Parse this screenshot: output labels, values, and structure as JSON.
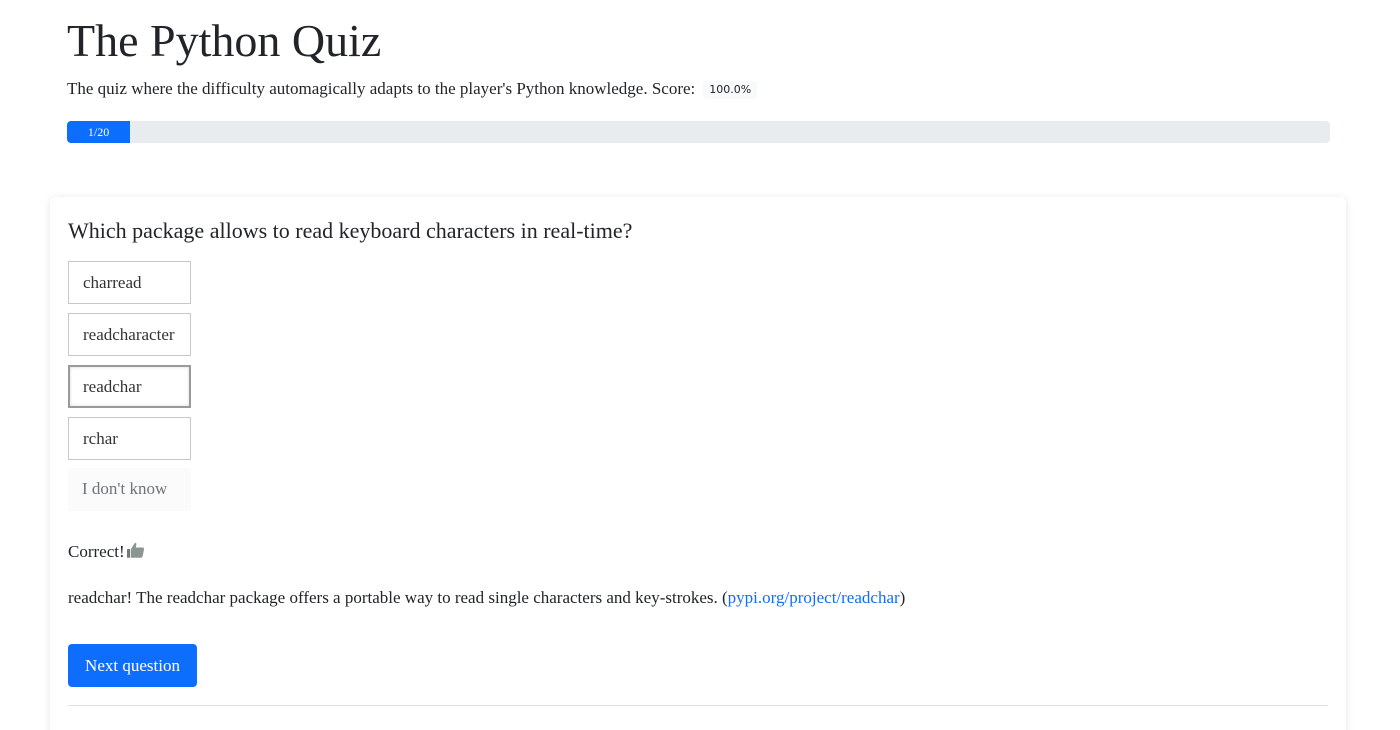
{
  "header": {
    "title": "The Python Quiz",
    "subtitle": "The quiz where the difficulty automagically adapts to the player's Python knowledge. Score:",
    "score": "100.0%"
  },
  "progress": {
    "label": "1/20",
    "current": 1,
    "total": 20,
    "color": "#0d6efd"
  },
  "quiz": {
    "question": "Which package allows to read keyboard characters in real-time?",
    "answers": [
      {
        "label": "charread",
        "selected": false
      },
      {
        "label": "readcharacter",
        "selected": false
      },
      {
        "label": "readchar",
        "selected": true
      },
      {
        "label": "rchar",
        "selected": false
      }
    ],
    "dont_know": "I don't know",
    "feedback": "Correct!",
    "feedback_icon": "thumbs-up-icon",
    "explanation_text": "readchar! The readchar package offers a portable way to read single characters and key-strokes. (",
    "explanation_link": "pypi.org/project/readchar",
    "explanation_close": ")",
    "next_button": "Next question"
  }
}
